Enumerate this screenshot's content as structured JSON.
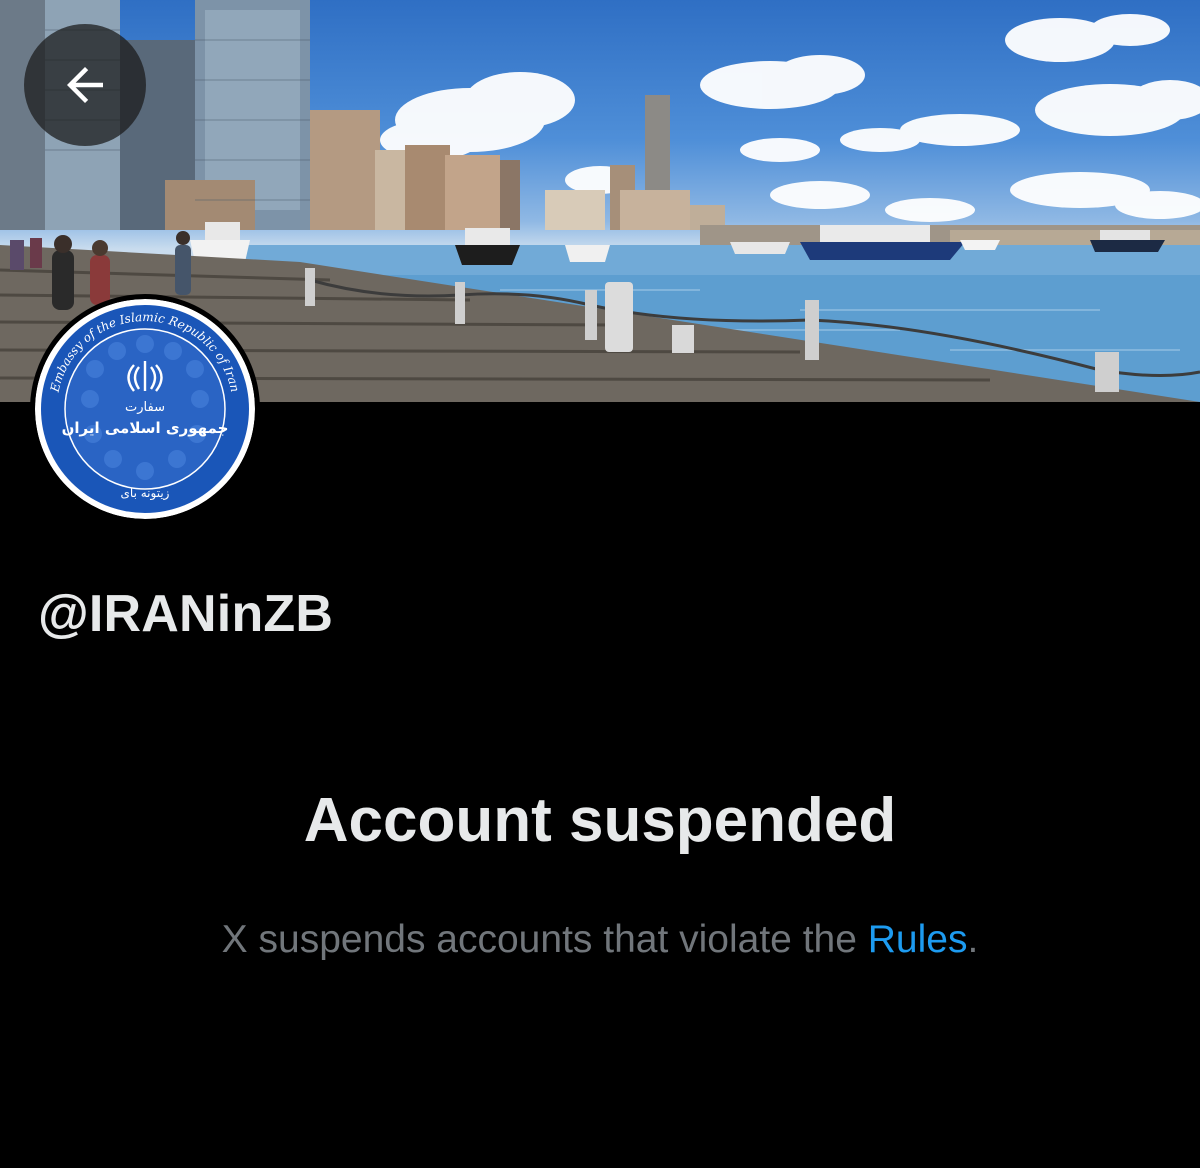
{
  "profile": {
    "handle": "@IRANinZB",
    "avatar_seal": {
      "ring_text": "Embassy of the Islamic Republic of Iran",
      "line1": "سفارت",
      "line2": "جمهوری اسلامی ایران",
      "bottom": "زیتونه بای"
    }
  },
  "suspension": {
    "title": "Account suspended",
    "message_prefix": "X suspends accounts that violate the ",
    "rules_link": "Rules",
    "message_suffix": "."
  },
  "icons": {
    "back": "arrow-left-icon",
    "emblem": "iran-emblem-icon"
  },
  "colors": {
    "background": "#000000",
    "text_primary": "#e7e9ea",
    "text_secondary": "#71767b",
    "link": "#1d9bf0",
    "seal_blue": "#1a56b8"
  }
}
